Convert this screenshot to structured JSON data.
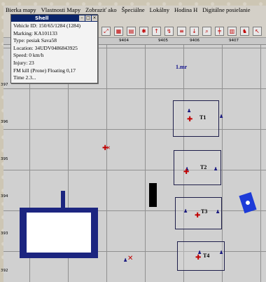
{
  "menu": {
    "items": [
      "Bierka mapy",
      "Vlastnosti Mapy",
      "Zobraziť ako",
      "Špeciálne",
      "Lokálny",
      "Hodina H",
      "Digitálne posielanie"
    ]
  },
  "ruler": {
    "ticks": [
      "9402",
      "9403",
      "9404",
      "9405",
      "9406",
      "9407"
    ]
  },
  "map": {
    "row_labels": [
      "397",
      "396",
      "395",
      "394",
      "393",
      "392"
    ],
    "scale_label": "1.mr",
    "targets": [
      {
        "label": "T1"
      },
      {
        "label": "T2"
      },
      {
        "label": "T3"
      },
      {
        "label": "T4"
      }
    ]
  },
  "popup": {
    "title": "Shell",
    "lines": [
      "Vehicle ID: 150/65/1284 (1284)",
      "Marking: KA101133",
      "Type: pesiak Sava58",
      "Location: 34UDV0486843925",
      "Speed: 0 km/h",
      "Injury: 23",
      "FM kill (Prone) Floating 0,17",
      "Time 2.3..."
    ]
  },
  "colors": {
    "building_blue": "#1c2580",
    "marker_blue": "#1d3bd8",
    "title_bar": "#0a246a",
    "red_marker": "#c00000"
  }
}
